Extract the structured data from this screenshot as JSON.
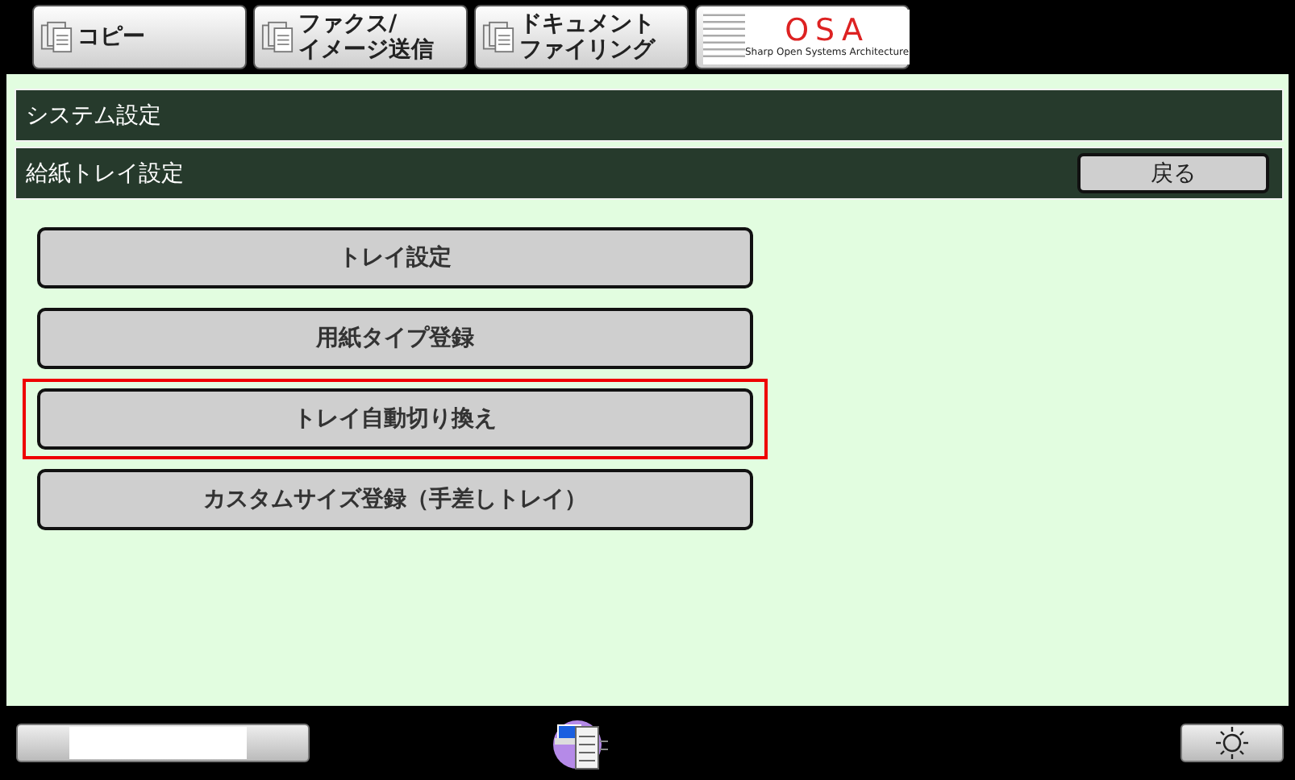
{
  "mode_tabs": [
    {
      "kind": "icon",
      "label_lines": [
        "コピー"
      ]
    },
    {
      "kind": "icon",
      "label_lines": [
        "ファクス/",
        "イメージ送信"
      ]
    },
    {
      "kind": "icon",
      "label_lines": [
        "ドキュメント",
        "ファイリング"
      ]
    },
    {
      "kind": "logo",
      "logo": "OSA",
      "tagline": "Sharp Open Systems Architecture"
    }
  ],
  "breadcrumb": {
    "title": "システム設定",
    "subtitle": "給紙トレイ設定",
    "back_button": "戻る"
  },
  "menu": [
    {
      "label": "トレイ設定",
      "selected": false
    },
    {
      "label": "用紙タイプ登録",
      "selected": false
    },
    {
      "label": "トレイ自動切り換え",
      "selected": true
    },
    {
      "label": "カスタムサイズ登録（手差しトレイ）",
      "selected": false
    }
  ]
}
